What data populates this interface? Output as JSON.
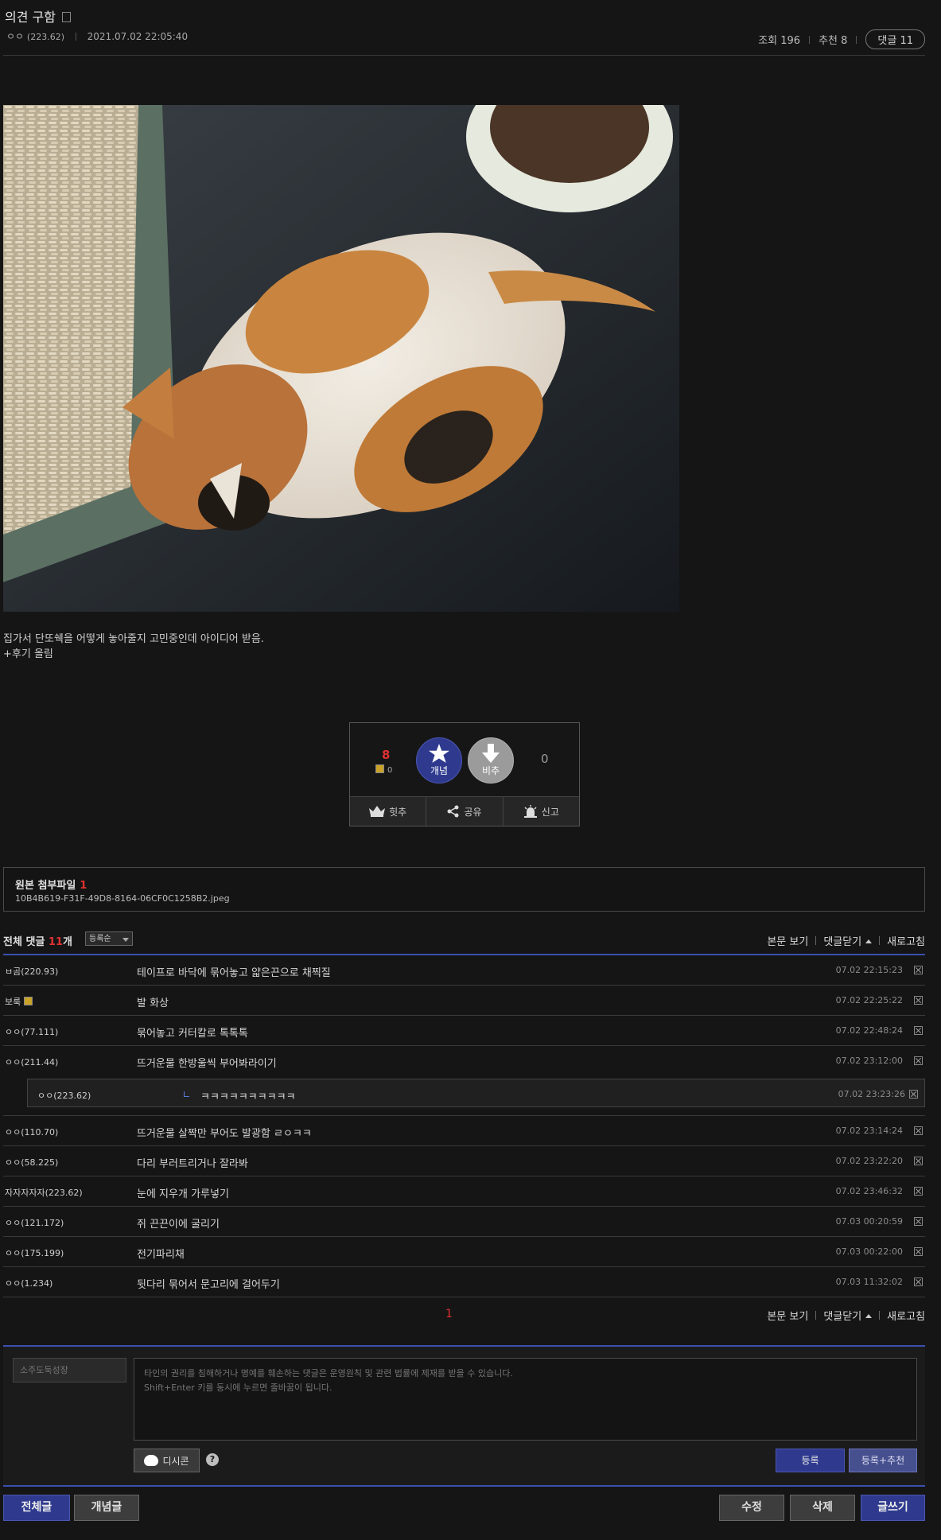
{
  "post": {
    "title": "의견 구함",
    "author": "ㅇㅇ",
    "author_ip": "(223.62)",
    "datetime": "2021.07.02 22:05:40",
    "views_label": "조회 196",
    "recommend_label": "추천 8",
    "comments_badge": "댓글 11",
    "body_lines": [
      "집가서 단또쉑을 어떻게 놓아줄지 고민중인데 아이디어 받음.",
      "+후기 올림"
    ]
  },
  "vote": {
    "up_count": "8",
    "fixed_count": "0",
    "up_label": "개념",
    "down_label": "비추",
    "down_count": "0",
    "actions": [
      "힛추",
      "공유",
      "신고"
    ]
  },
  "attachment": {
    "title": "원본 첨부파일",
    "count": "1",
    "filename": "10B4B619-F31F-49D8-8164-06CF0C1258B2.jpeg"
  },
  "comments_header": {
    "total_prefix": "전체 댓글 ",
    "total_count": "11",
    "total_suffix": "개",
    "sort": "등록순",
    "links": [
      "본문 보기",
      "댓글닫기",
      "새로고침"
    ]
  },
  "comments": [
    {
      "nick": "ㅂ곰(220.93)",
      "text": "테이프로 바닥에 묶어놓고 얇은끈으로 채찍질",
      "date": "07.02 22:15:23"
    },
    {
      "nick": "보룩",
      "fixed": true,
      "text": "발 화상",
      "date": "07.02 22:25:22"
    },
    {
      "nick": "ㅇㅇ(77.111)",
      "text": "묶어놓고 커터칼로 톡톡톡",
      "date": "07.02 22:48:24"
    },
    {
      "nick": "ㅇㅇ(211.44)",
      "text": "뜨거운물 한방울씩 부어봐라이기",
      "date": "07.02 23:12:00"
    },
    {
      "nick": "ㅇㅇ(223.62)",
      "reply": true,
      "text": "ㅋㅋㅋㅋㅋㅋㅋㅋㅋㅋ",
      "date": "07.02 23:23:26"
    },
    {
      "nick": "ㅇㅇ(110.70)",
      "text": "뜨거운물 살짝만 부어도 발광함 ㄹㅇㅋㅋ",
      "date": "07.02 23:14:24"
    },
    {
      "nick": "ㅇㅇ(58.225)",
      "text": "다리 부러트리거나 잘라봐",
      "date": "07.02 23:22:20"
    },
    {
      "nick": "자자자자자(223.62)",
      "text": "눈에 지우개 가루넣기",
      "date": "07.02 23:46:32"
    },
    {
      "nick": "ㅇㅇ(121.172)",
      "text": "쥐 끈끈이에 굴리기",
      "date": "07.03 00:20:59"
    },
    {
      "nick": "ㅇㅇ(175.199)",
      "text": "전기파리채",
      "date": "07.03 00:22:00"
    },
    {
      "nick": "ㅇㅇ(1.234)",
      "text": "뒷다리 묶어서 문고리에 걸어두기",
      "date": "07.03 11:32:02"
    }
  ],
  "pagination": {
    "current": "1"
  },
  "write": {
    "nick_placeholder": "소주도둑성장",
    "textarea_placeholder": "타인의 권리를 침해하거나 명예를 훼손하는 댓글은 운영원칙 및 관련 법률에 제재를 받을 수 있습니다.\nShift+Enter 키를 동시에 누르면 줄바꿈이 됩니다.",
    "dccon_label": "디시콘",
    "help": "?",
    "submit": "등록",
    "submit_recommend": "등록+추천"
  },
  "bottom": {
    "all_posts": "전체글",
    "concept_posts": "개념글",
    "edit": "수정",
    "delete": "삭제",
    "write": "글쓰기"
  },
  "colors": {
    "accent_blue": "#2f3a8f",
    "accent_red": "#e03131",
    "bg": "#151515"
  }
}
